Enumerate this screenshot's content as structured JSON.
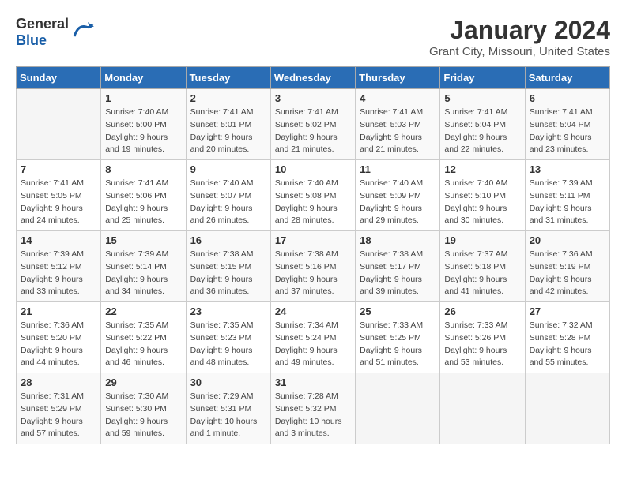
{
  "header": {
    "logo_general": "General",
    "logo_blue": "Blue",
    "title": "January 2024",
    "subtitle": "Grant City, Missouri, United States"
  },
  "weekdays": [
    "Sunday",
    "Monday",
    "Tuesday",
    "Wednesday",
    "Thursday",
    "Friday",
    "Saturday"
  ],
  "weeks": [
    [
      {
        "day": "",
        "sunrise": "",
        "sunset": "",
        "daylight": ""
      },
      {
        "day": "1",
        "sunrise": "Sunrise: 7:40 AM",
        "sunset": "Sunset: 5:00 PM",
        "daylight": "Daylight: 9 hours and 19 minutes."
      },
      {
        "day": "2",
        "sunrise": "Sunrise: 7:41 AM",
        "sunset": "Sunset: 5:01 PM",
        "daylight": "Daylight: 9 hours and 20 minutes."
      },
      {
        "day": "3",
        "sunrise": "Sunrise: 7:41 AM",
        "sunset": "Sunset: 5:02 PM",
        "daylight": "Daylight: 9 hours and 21 minutes."
      },
      {
        "day": "4",
        "sunrise": "Sunrise: 7:41 AM",
        "sunset": "Sunset: 5:03 PM",
        "daylight": "Daylight: 9 hours and 21 minutes."
      },
      {
        "day": "5",
        "sunrise": "Sunrise: 7:41 AM",
        "sunset": "Sunset: 5:04 PM",
        "daylight": "Daylight: 9 hours and 22 minutes."
      },
      {
        "day": "6",
        "sunrise": "Sunrise: 7:41 AM",
        "sunset": "Sunset: 5:04 PM",
        "daylight": "Daylight: 9 hours and 23 minutes."
      }
    ],
    [
      {
        "day": "7",
        "sunrise": "Sunrise: 7:41 AM",
        "sunset": "Sunset: 5:05 PM",
        "daylight": "Daylight: 9 hours and 24 minutes."
      },
      {
        "day": "8",
        "sunrise": "Sunrise: 7:41 AM",
        "sunset": "Sunset: 5:06 PM",
        "daylight": "Daylight: 9 hours and 25 minutes."
      },
      {
        "day": "9",
        "sunrise": "Sunrise: 7:40 AM",
        "sunset": "Sunset: 5:07 PM",
        "daylight": "Daylight: 9 hours and 26 minutes."
      },
      {
        "day": "10",
        "sunrise": "Sunrise: 7:40 AM",
        "sunset": "Sunset: 5:08 PM",
        "daylight": "Daylight: 9 hours and 28 minutes."
      },
      {
        "day": "11",
        "sunrise": "Sunrise: 7:40 AM",
        "sunset": "Sunset: 5:09 PM",
        "daylight": "Daylight: 9 hours and 29 minutes."
      },
      {
        "day": "12",
        "sunrise": "Sunrise: 7:40 AM",
        "sunset": "Sunset: 5:10 PM",
        "daylight": "Daylight: 9 hours and 30 minutes."
      },
      {
        "day": "13",
        "sunrise": "Sunrise: 7:39 AM",
        "sunset": "Sunset: 5:11 PM",
        "daylight": "Daylight: 9 hours and 31 minutes."
      }
    ],
    [
      {
        "day": "14",
        "sunrise": "Sunrise: 7:39 AM",
        "sunset": "Sunset: 5:12 PM",
        "daylight": "Daylight: 9 hours and 33 minutes."
      },
      {
        "day": "15",
        "sunrise": "Sunrise: 7:39 AM",
        "sunset": "Sunset: 5:14 PM",
        "daylight": "Daylight: 9 hours and 34 minutes."
      },
      {
        "day": "16",
        "sunrise": "Sunrise: 7:38 AM",
        "sunset": "Sunset: 5:15 PM",
        "daylight": "Daylight: 9 hours and 36 minutes."
      },
      {
        "day": "17",
        "sunrise": "Sunrise: 7:38 AM",
        "sunset": "Sunset: 5:16 PM",
        "daylight": "Daylight: 9 hours and 37 minutes."
      },
      {
        "day": "18",
        "sunrise": "Sunrise: 7:38 AM",
        "sunset": "Sunset: 5:17 PM",
        "daylight": "Daylight: 9 hours and 39 minutes."
      },
      {
        "day": "19",
        "sunrise": "Sunrise: 7:37 AM",
        "sunset": "Sunset: 5:18 PM",
        "daylight": "Daylight: 9 hours and 41 minutes."
      },
      {
        "day": "20",
        "sunrise": "Sunrise: 7:36 AM",
        "sunset": "Sunset: 5:19 PM",
        "daylight": "Daylight: 9 hours and 42 minutes."
      }
    ],
    [
      {
        "day": "21",
        "sunrise": "Sunrise: 7:36 AM",
        "sunset": "Sunset: 5:20 PM",
        "daylight": "Daylight: 9 hours and 44 minutes."
      },
      {
        "day": "22",
        "sunrise": "Sunrise: 7:35 AM",
        "sunset": "Sunset: 5:22 PM",
        "daylight": "Daylight: 9 hours and 46 minutes."
      },
      {
        "day": "23",
        "sunrise": "Sunrise: 7:35 AM",
        "sunset": "Sunset: 5:23 PM",
        "daylight": "Daylight: 9 hours and 48 minutes."
      },
      {
        "day": "24",
        "sunrise": "Sunrise: 7:34 AM",
        "sunset": "Sunset: 5:24 PM",
        "daylight": "Daylight: 9 hours and 49 minutes."
      },
      {
        "day": "25",
        "sunrise": "Sunrise: 7:33 AM",
        "sunset": "Sunset: 5:25 PM",
        "daylight": "Daylight: 9 hours and 51 minutes."
      },
      {
        "day": "26",
        "sunrise": "Sunrise: 7:33 AM",
        "sunset": "Sunset: 5:26 PM",
        "daylight": "Daylight: 9 hours and 53 minutes."
      },
      {
        "day": "27",
        "sunrise": "Sunrise: 7:32 AM",
        "sunset": "Sunset: 5:28 PM",
        "daylight": "Daylight: 9 hours and 55 minutes."
      }
    ],
    [
      {
        "day": "28",
        "sunrise": "Sunrise: 7:31 AM",
        "sunset": "Sunset: 5:29 PM",
        "daylight": "Daylight: 9 hours and 57 minutes."
      },
      {
        "day": "29",
        "sunrise": "Sunrise: 7:30 AM",
        "sunset": "Sunset: 5:30 PM",
        "daylight": "Daylight: 9 hours and 59 minutes."
      },
      {
        "day": "30",
        "sunrise": "Sunrise: 7:29 AM",
        "sunset": "Sunset: 5:31 PM",
        "daylight": "Daylight: 10 hours and 1 minute."
      },
      {
        "day": "31",
        "sunrise": "Sunrise: 7:28 AM",
        "sunset": "Sunset: 5:32 PM",
        "daylight": "Daylight: 10 hours and 3 minutes."
      },
      {
        "day": "",
        "sunrise": "",
        "sunset": "",
        "daylight": ""
      },
      {
        "day": "",
        "sunrise": "",
        "sunset": "",
        "daylight": ""
      },
      {
        "day": "",
        "sunrise": "",
        "sunset": "",
        "daylight": ""
      }
    ]
  ]
}
